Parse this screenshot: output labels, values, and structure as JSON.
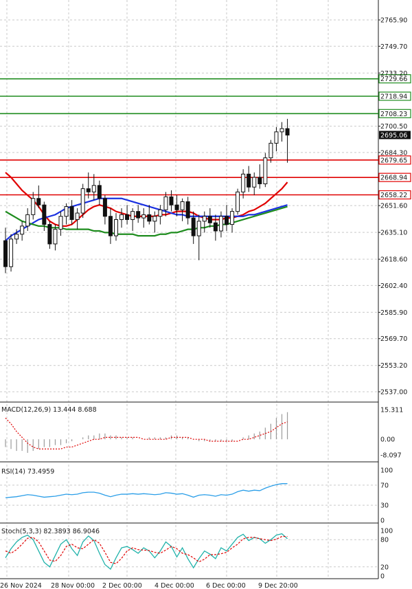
{
  "chart_data": {
    "type": "candlestick",
    "instrument_note": "",
    "price_axis": {
      "ticks": [
        "2765.90",
        "2749.70",
        "2733.20",
        "2700.50",
        "2684.30",
        "2651.60",
        "2635.10",
        "2618.60",
        "2602.40",
        "2585.90",
        "2569.70",
        "2553.20",
        "2537.00"
      ],
      "range": [
        2530,
        2780
      ],
      "current_price": "2695.06"
    },
    "levels": [
      {
        "value": 2729.66,
        "label": "2729.66",
        "color": "#1e8c1e"
      },
      {
        "value": 2718.94,
        "label": "2718.94",
        "color": "#1e8c1e"
      },
      {
        "value": 2708.23,
        "label": "2708.23",
        "color": "#1e8c1e"
      },
      {
        "value": 2679.65,
        "label": "2679.65",
        "color": "#e00000"
      },
      {
        "value": 2668.94,
        "label": "2668.94",
        "color": "#e00000"
      },
      {
        "value": 2658.22,
        "label": "2658.22",
        "color": "#e00000"
      }
    ],
    "x_axis": {
      "labels": [
        "26 Nov 2024",
        "28 Nov 00:00",
        "2 Dec 00:00",
        "4 Dec 00:00",
        "6 Dec 00:00",
        "9 Dec 20:00"
      ]
    },
    "candles": [
      [
        2630,
        2638,
        2610,
        2614
      ],
      [
        2614,
        2634,
        2611,
        2631
      ],
      [
        2631,
        2637,
        2628,
        2634
      ],
      [
        2634,
        2642,
        2630,
        2639
      ],
      [
        2639,
        2650,
        2636,
        2646
      ],
      [
        2646,
        2660,
        2643,
        2656
      ],
      [
        2656,
        2664,
        2650,
        2652
      ],
      [
        2652,
        2654,
        2636,
        2640
      ],
      [
        2640,
        2642,
        2625,
        2628
      ],
      [
        2628,
        2640,
        2624,
        2637
      ],
      [
        2637,
        2648,
        2633,
        2645
      ],
      [
        2645,
        2653,
        2640,
        2651
      ],
      [
        2651,
        2655,
        2640,
        2643
      ],
      [
        2643,
        2650,
        2637,
        2647
      ],
      [
        2647,
        2665,
        2644,
        2662
      ],
      [
        2662,
        2672,
        2656,
        2660
      ],
      [
        2660,
        2671,
        2655,
        2664
      ],
      [
        2664,
        2667,
        2652,
        2656
      ],
      [
        2656,
        2658,
        2640,
        2645
      ],
      [
        2645,
        2650,
        2628,
        2633
      ],
      [
        2633,
        2647,
        2630,
        2643
      ],
      [
        2643,
        2650,
        2638,
        2646
      ],
      [
        2646,
        2652,
        2640,
        2643
      ],
      [
        2643,
        2650,
        2636,
        2648
      ],
      [
        2648,
        2652,
        2641,
        2644
      ],
      [
        2644,
        2650,
        2638,
        2646
      ],
      [
        2646,
        2652,
        2640,
        2642
      ],
      [
        2642,
        2648,
        2635,
        2645
      ],
      [
        2645,
        2652,
        2640,
        2649
      ],
      [
        2649,
        2660,
        2645,
        2657
      ],
      [
        2657,
        2661,
        2648,
        2652
      ],
      [
        2652,
        2658,
        2645,
        2649
      ],
      [
        2649,
        2656,
        2642,
        2654
      ],
      [
        2654,
        2657,
        2640,
        2644
      ],
      [
        2644,
        2648,
        2628,
        2633
      ],
      [
        2633,
        2646,
        2618,
        2642
      ],
      [
        2642,
        2648,
        2635,
        2645
      ],
      [
        2645,
        2650,
        2638,
        2641
      ],
      [
        2641,
        2646,
        2630,
        2636
      ],
      [
        2636,
        2648,
        2632,
        2645
      ],
      [
        2645,
        2652,
        2636,
        2640
      ],
      [
        2640,
        2650,
        2635,
        2648
      ],
      [
        2648,
        2662,
        2646,
        2660
      ],
      [
        2660,
        2674,
        2656,
        2671
      ],
      [
        2671,
        2676,
        2660,
        2663
      ],
      [
        2663,
        2672,
        2658,
        2669
      ],
      [
        2669,
        2677,
        2662,
        2665
      ],
      [
        2665,
        2684,
        2663,
        2681
      ],
      [
        2681,
        2692,
        2678,
        2690
      ],
      [
        2690,
        2700,
        2685,
        2697
      ],
      [
        2697,
        2703,
        2691,
        2699
      ],
      [
        2699,
        2705,
        2678,
        2695
      ]
    ],
    "moving_averages": [
      {
        "color": "#e00000",
        "values": [
          2672,
          2669,
          2665,
          2661,
          2658,
          2655,
          2651,
          2646,
          2642,
          2640,
          2639,
          2639,
          2640,
          2643,
          2646,
          2649,
          2651,
          2652,
          2651,
          2650,
          2648,
          2647,
          2646,
          2645,
          2645,
          2645,
          2645,
          2645,
          2646,
          2646,
          2647,
          2648,
          2648,
          2648,
          2647,
          2645,
          2644,
          2643,
          2643,
          2643,
          2644,
          2644,
          2645,
          2646,
          2648,
          2649,
          2651,
          2653,
          2656,
          2659,
          2662,
          2666
        ]
      },
      {
        "color": "#1a30e0",
        "values": [
          2630,
          2633,
          2635,
          2637,
          2639,
          2641,
          2643,
          2644,
          2645,
          2646,
          2648,
          2650,
          2651,
          2652,
          2653,
          2654,
          2655,
          2656,
          2656,
          2656,
          2656,
          2656,
          2655,
          2654,
          2653,
          2652,
          2651,
          2650,
          2649,
          2648,
          2647,
          2646,
          2646,
          2645,
          2645,
          2645,
          2645,
          2645,
          2645,
          2645,
          2645,
          2645,
          2645,
          2645,
          2646,
          2646,
          2647,
          2648,
          2649,
          2650,
          2651,
          2652
        ]
      },
      {
        "color": "#1e8c1e",
        "values": [
          2648,
          2646,
          2644,
          2642,
          2641,
          2640,
          2639,
          2639,
          2638,
          2638,
          2638,
          2637,
          2637,
          2637,
          2637,
          2637,
          2636,
          2636,
          2635,
          2635,
          2634,
          2634,
          2634,
          2634,
          2633,
          2633,
          2633,
          2633,
          2634,
          2634,
          2635,
          2635,
          2636,
          2637,
          2637,
          2638,
          2638,
          2639,
          2639,
          2640,
          2640,
          2641,
          2642,
          2643,
          2644,
          2645,
          2646,
          2647,
          2648,
          2649,
          2650,
          2651
        ]
      }
    ],
    "macd": {
      "label": "MACD(12,26,9) 13.444 8.688",
      "ticks": [
        "15.311",
        "0.00",
        "-8.097"
      ],
      "range": [
        -8.097,
        15.311
      ],
      "histogram": [
        -4,
        -5,
        -6,
        -6,
        -7,
        -6,
        -5,
        -4,
        -4,
        -3,
        -3,
        -2,
        -1,
        0,
        1,
        2,
        2,
        3,
        3,
        2,
        2,
        1,
        1,
        1,
        0,
        0,
        1,
        1,
        1,
        1,
        2,
        2,
        1,
        1,
        0,
        -1,
        -1,
        -1,
        -1,
        -1,
        -1,
        -1,
        0,
        1,
        2,
        3,
        4,
        6,
        8,
        11,
        13,
        14
      ],
      "signal": [
        11,
        8,
        4,
        1,
        -2,
        -4,
        -5,
        -5,
        -5,
        -5,
        -5,
        -4,
        -4,
        -3,
        -2,
        -1,
        0,
        0,
        1,
        1,
        1,
        1,
        1,
        1,
        1,
        0,
        0,
        0,
        0,
        0,
        1,
        1,
        1,
        1,
        0,
        0,
        0,
        -1,
        -1,
        -1,
        -1,
        -1,
        -1,
        0,
        0,
        1,
        2,
        3,
        4,
        6,
        8,
        9
      ]
    },
    "rsi": {
      "label": "RSI(14) 73.4959",
      "ticks": [
        "100",
        "70",
        "30",
        "0"
      ],
      "values": [
        45,
        46,
        47,
        49,
        51,
        50,
        48,
        46,
        47,
        48,
        50,
        52,
        51,
        52,
        55,
        56,
        56,
        54,
        50,
        47,
        50,
        52,
        52,
        53,
        52,
        53,
        52,
        51,
        52,
        55,
        54,
        52,
        53,
        50,
        46,
        50,
        51,
        50,
        48,
        51,
        50,
        52,
        57,
        60,
        58,
        60,
        59,
        64,
        68,
        71,
        73,
        73
      ]
    },
    "stoch": {
      "label": "Stoch(5,3,3) 82.3893 86.9046",
      "ticks": [
        "100",
        "80",
        "20",
        "0"
      ],
      "k": [
        40,
        60,
        75,
        85,
        90,
        80,
        55,
        30,
        20,
        45,
        70,
        80,
        60,
        45,
        75,
        88,
        78,
        50,
        25,
        15,
        40,
        62,
        65,
        58,
        50,
        62,
        55,
        40,
        55,
        75,
        65,
        42,
        62,
        38,
        18,
        38,
        55,
        48,
        38,
        62,
        55,
        70,
        85,
        92,
        78,
        85,
        82,
        72,
        80,
        90,
        93,
        82
      ],
      "d": [
        55,
        50,
        58,
        70,
        83,
        85,
        75,
        55,
        35,
        32,
        45,
        65,
        70,
        62,
        60,
        70,
        80,
        72,
        52,
        30,
        27,
        39,
        55,
        62,
        58,
        57,
        56,
        52,
        50,
        57,
        65,
        60,
        50,
        47,
        40,
        31,
        37,
        47,
        47,
        49,
        52,
        62,
        70,
        82,
        85,
        85,
        82,
        80,
        78,
        81,
        87,
        87
      ]
    }
  }
}
